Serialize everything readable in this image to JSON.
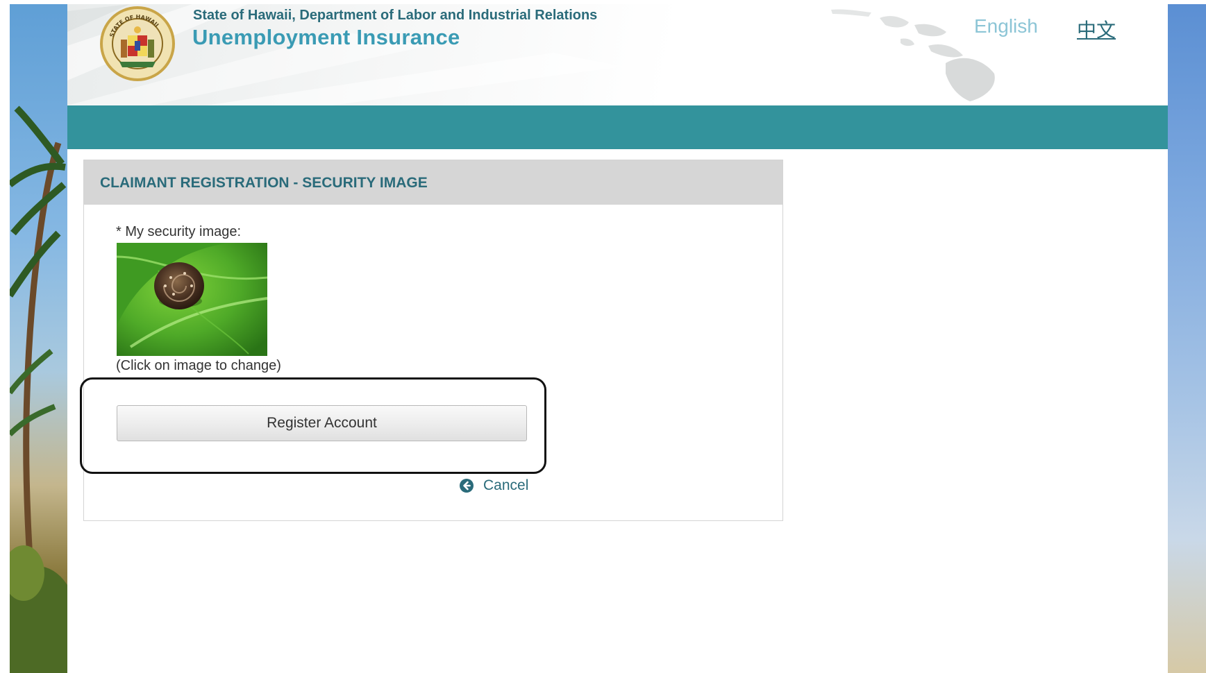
{
  "header": {
    "org_name": "State of Hawaii, Department of Labor and Industrial Relations",
    "app_title": "Unemployment Insurance",
    "languages": [
      {
        "label": "English"
      },
      {
        "label": "中文"
      }
    ]
  },
  "panel": {
    "title": "CLAIMANT REGISTRATION - SECURITY IMAGE",
    "security_label": "* My security image:",
    "security_image": "snail-on-leaf",
    "change_hint": "(Click on image to change)",
    "register_label": "Register Account",
    "cancel_label": "Cancel",
    "cancel_icon": "circle-arrow-left-icon"
  },
  "colors": {
    "teal_bar": "#33939c",
    "title_teal": "#3a9bb4",
    "dark_teal": "#2a6b7a",
    "panel_header": "#d6d6d6"
  }
}
